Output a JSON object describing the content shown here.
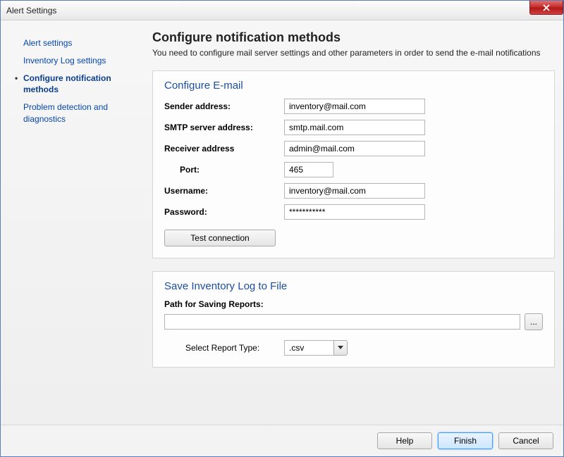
{
  "window": {
    "title": "Alert Settings"
  },
  "sidebar": {
    "items": [
      {
        "label": "Alert settings"
      },
      {
        "label": "Inventory Log settings"
      },
      {
        "label": "Configure notification methods"
      },
      {
        "label": "Problem detection and diagnostics"
      }
    ],
    "activeIndex": 2
  },
  "page": {
    "title": "Configure notification methods",
    "subtitle": "You need to configure mail server settings and other parameters in order to send the e-mail notifications"
  },
  "email": {
    "panelTitle": "Configure E-mail",
    "labels": {
      "sender": "Sender address:",
      "smtp": "SMTP server address:",
      "receiver": "Receiver address",
      "port": "Port:",
      "username": "Username:",
      "password": "Password:"
    },
    "values": {
      "sender": "inventory@mail.com",
      "smtp": "smtp.mail.com",
      "receiver": "admin@mail.com",
      "port": "465",
      "username": "inventory@mail.com",
      "password": "***********"
    },
    "testButton": "Test connection"
  },
  "saveLog": {
    "panelTitle": "Save Inventory Log to File",
    "pathLabel": "Path for Saving Reports:",
    "pathValue": "",
    "browseLabel": "...",
    "selectTypeLabel": "Select Report Type:",
    "selectedType": ".csv"
  },
  "footer": {
    "help": "Help",
    "finish": "Finish",
    "cancel": "Cancel"
  }
}
